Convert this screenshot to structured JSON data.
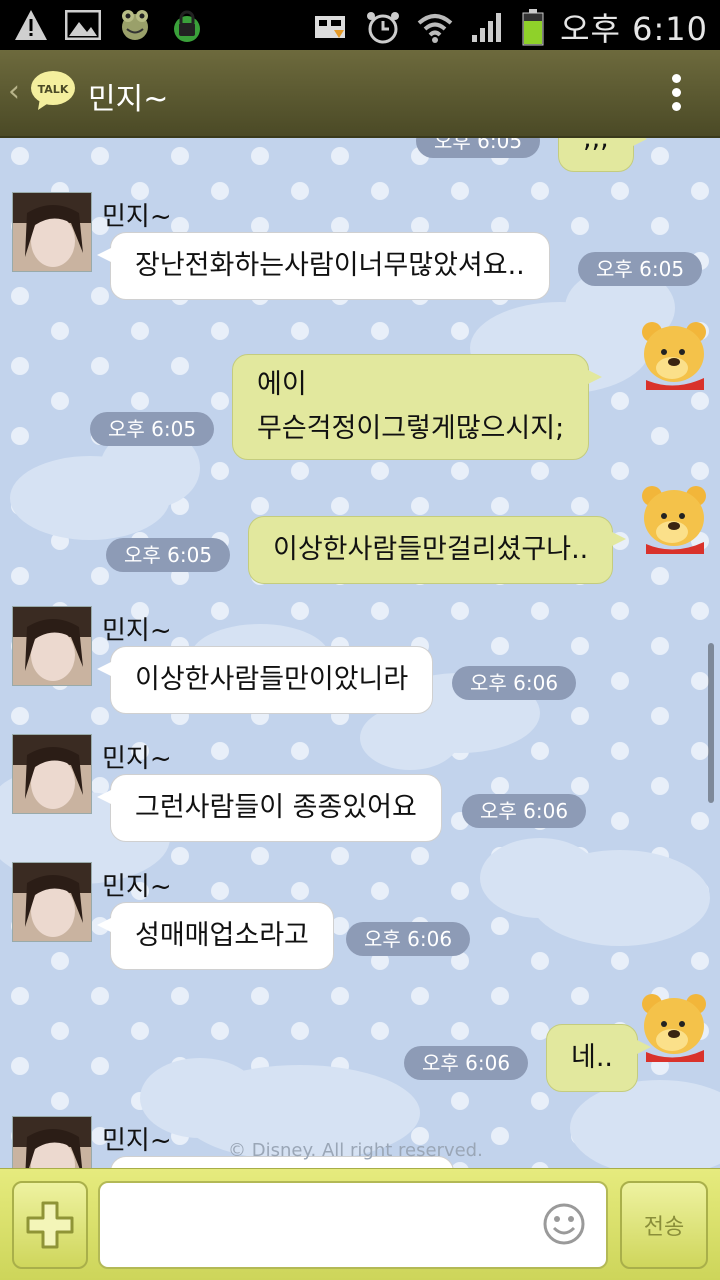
{
  "status_bar": {
    "time": "오후 6:10",
    "left_icons": [
      "warning-icon",
      "image-icon",
      "frog-icon",
      "lock-icon"
    ],
    "right_icons": [
      "cast-icon",
      "alarm-icon",
      "wifi-icon",
      "signal-icon",
      "battery-icon"
    ]
  },
  "header": {
    "logo_text": "TALK",
    "title": "민지~"
  },
  "messages": [
    {
      "sender": "민지~",
      "text": "장난전화하는사람이너무많았셔요..",
      "time": "오후 6:05"
    },
    {
      "line1": "에이",
      "line2": "무슨걱정이그렇게많으시지;",
      "time": "오후 6:05"
    },
    {
      "text": "이상한사람들만걸리셨구나..",
      "time": "오후 6:05"
    },
    {
      "sender": "민지~",
      "text": "이상한사람들만이았니라",
      "time": "오후 6:06"
    },
    {
      "sender": "민지~",
      "text": "그런사람들이 종종있어요",
      "time": "오후 6:06"
    },
    {
      "sender": "민지~",
      "text": "성매매업소라고",
      "time": "오후 6:06"
    },
    {
      "text": "네..",
      "time": "오후 6:06"
    },
    {
      "sender": "민지~"
    }
  ],
  "top_partial": {
    "text": ",,,",
    "time": "오후 6:05"
  },
  "watermark": "© Disney. All right reserved.",
  "input": {
    "value": "",
    "placeholder": ""
  },
  "send_label": "전송",
  "colors": {
    "header": "#5a5830",
    "chat_background": "#c9d9ef",
    "outgoing_bubble": "#e2e89e",
    "incoming_bubble": "#ffffff",
    "time_pill": "#8d9bb6",
    "input_bar": "#dce36c"
  }
}
